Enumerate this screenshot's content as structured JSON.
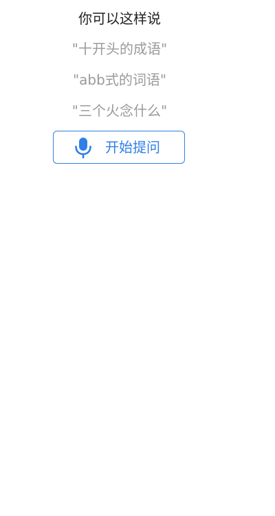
{
  "header": {
    "title": "你可以这样说"
  },
  "suggestions": [
    "\"十开头的成语\"",
    "\"abb式的词语\"",
    "\"三个火念什么\""
  ],
  "ask_button": {
    "label": "开始提问",
    "icon": "microphone-icon"
  },
  "colors": {
    "accent": "#2f7fe6",
    "title_text": "#222222",
    "suggestion_text": "#9a9a9a"
  }
}
